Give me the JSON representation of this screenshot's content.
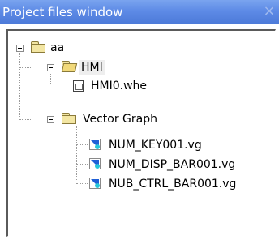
{
  "window": {
    "title": "Project files window",
    "close_symbol": "×"
  },
  "tree": {
    "root": {
      "label": "aa",
      "expanded": true,
      "icon": "folder-icon"
    },
    "hmi": {
      "label": "HMI",
      "expanded": true,
      "icon": "folder-open-icon"
    },
    "hmi_file": {
      "label": "HMI0.whe",
      "icon": "screen-file-icon"
    },
    "vector_graph": {
      "label": "Vector Graph",
      "expanded": true,
      "icon": "folder-icon"
    },
    "vg_files": [
      {
        "label": "NUM_KEY001.vg",
        "icon": "vector-graphic-icon"
      },
      {
        "label": "NUM_DISP_BAR001.vg",
        "icon": "vector-graphic-icon"
      },
      {
        "label": "NUB_CTRL_BAR001.vg",
        "icon": "vector-graphic-icon"
      }
    ]
  },
  "colors": {
    "title_bar": "#5d8ae6",
    "folder_fill": "#f3e6a3",
    "vg_icon_blue": "#1f5fd6",
    "vg_icon_cyan": "#26c6d9"
  }
}
